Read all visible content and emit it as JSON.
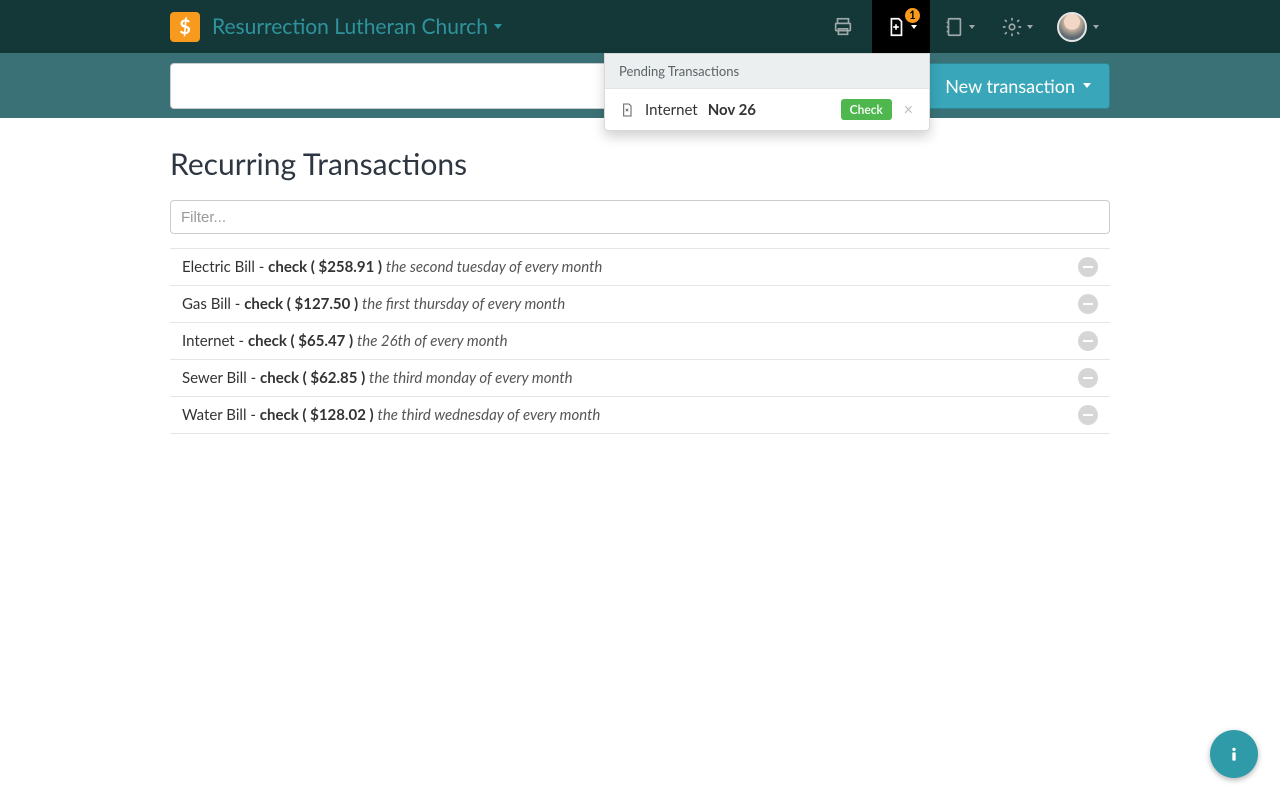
{
  "header": {
    "org_name": "Resurrection Lutheran Church",
    "pending_badge": "1"
  },
  "subbar": {
    "search_value": "",
    "new_transaction_label": "New transaction"
  },
  "dropdown": {
    "title": "Pending Transactions",
    "item": {
      "name": "Internet",
      "date": "Nov 26",
      "badge": "Check"
    }
  },
  "page": {
    "title": "Recurring Transactions",
    "filter_placeholder": "Filter..."
  },
  "transactions": [
    {
      "name": "Electric Bill",
      "method": "check",
      "amount": "$258.91",
      "schedule": "the second tuesday of every month"
    },
    {
      "name": "Gas Bill",
      "method": "check",
      "amount": "$127.50",
      "schedule": "the first thursday of every month"
    },
    {
      "name": "Internet",
      "method": "check",
      "amount": "$65.47",
      "schedule": "the 26th of every month"
    },
    {
      "name": "Sewer Bill",
      "method": "check",
      "amount": "$62.85",
      "schedule": "the third monday of every month"
    },
    {
      "name": "Water Bill",
      "method": "check",
      "amount": "$128.02",
      "schedule": "the third wednesday of every month"
    }
  ]
}
